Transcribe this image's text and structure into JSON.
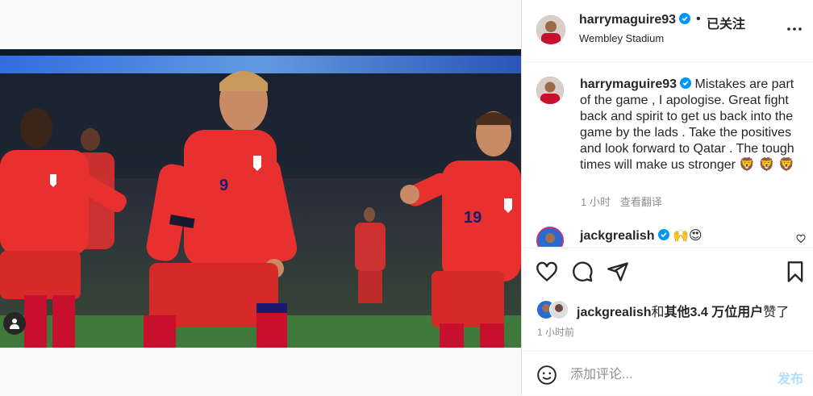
{
  "post": {
    "author": "harrymaguire93",
    "follow_label": "已关注",
    "separator": "•",
    "location": "Wembley Stadium",
    "photo_alt": "England players celebrating a goal at Wembley"
  },
  "caption": {
    "username": "harrymaguire93",
    "text": "Mistakes are part of the game , I apologise. Great fight back and spirit to get us back into the game by the lads . Take the positives and look forward to Qatar . The tough times will make us stronger 🦁 🦁 🦁",
    "time": "1 小时",
    "translate_label": "查看翻译"
  },
  "next_comment": {
    "username": "jackgrealish",
    "text": "🙌😍"
  },
  "likes": {
    "user": "jackgrealish",
    "conjunction": "和",
    "others": "其他3.4 万位用户",
    "suffix": "赞了"
  },
  "posted_ago": "1 小时前",
  "comment_box": {
    "placeholder": "添加评论...",
    "post_label": "发布"
  },
  "icons": [
    "tag-user-icon",
    "verified-icon",
    "more-options-icon",
    "heart-icon",
    "comment-icon",
    "share-icon",
    "bookmark-icon",
    "emoji-icon",
    "small-heart-icon"
  ],
  "colors": {
    "verified": "#0095f6",
    "post_button": "#b2dffc",
    "kit_red": "#e8312f",
    "secondary_text": "#8e8e8e"
  }
}
